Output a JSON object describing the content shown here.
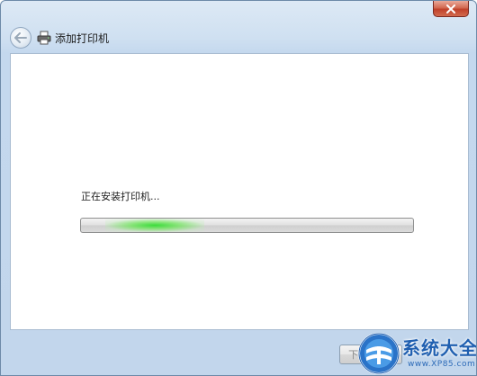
{
  "window": {
    "title": "添加打印机"
  },
  "content": {
    "status_text": "正在安装打印机..."
  },
  "progress": {
    "indeterminate": true,
    "glow_position": 0.14
  },
  "footer": {
    "next_label": "下一步(N)",
    "next_enabled": false
  },
  "watermark": {
    "brand": "系统大全",
    "url": "www.XP85.com"
  },
  "icons": {
    "close": "close-icon",
    "back": "back-arrow-icon",
    "printer": "printer-icon",
    "logo": "globe-logo-icon"
  },
  "colors": {
    "chrome": "#c2d6ec",
    "close_red": "#c0412a",
    "progress_green": "#3cdc3c",
    "watermark_blue": "#1f5fb0"
  }
}
